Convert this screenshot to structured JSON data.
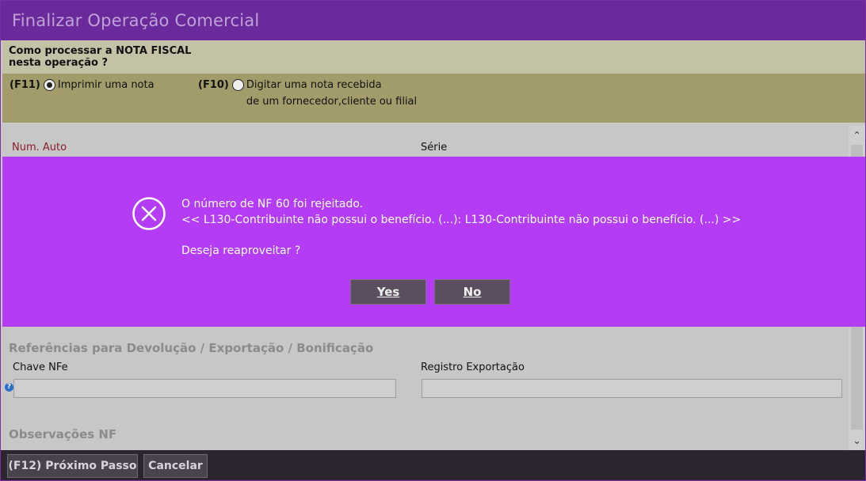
{
  "window": {
    "title": "Finalizar Operação Comercial"
  },
  "question": {
    "text_line1": "Como processar a NOTA FISCAL",
    "text_line2": "nesta operação ?"
  },
  "options": [
    {
      "key": "(F11)",
      "label_line1": "Imprimir uma nota",
      "label_line2": "",
      "selected": true
    },
    {
      "key": "(F10)",
      "label_line1": "Digitar uma nota recebida",
      "label_line2": "de um fornecedor,cliente ou filial",
      "selected": false
    }
  ],
  "form": {
    "num_auto_label": "Num. Auto",
    "serie_label": "Série",
    "references_heading": "Referências para Devolução / Exportação / Bonificação",
    "chave_nfe_label": "Chave NFe",
    "chave_nfe_value": "",
    "registro_exportacao_label": "Registro Exportação",
    "registro_exportacao_value": "",
    "observacoes_heading": "Observações NF",
    "help_glyph": "?"
  },
  "dialog": {
    "icon": "error-circle-x-icon",
    "line1": "O número de NF 60 foi rejeitado.",
    "line2": "<< L130-Contribuinte não possui o benefício. (...): L130-Contribuinte não possui o benefício. (...) >>",
    "line3": "Deseja reaproveitar ?",
    "yes_label": "Yes",
    "no_label": "No"
  },
  "footer": {
    "next_label": "(F12) Próximo Passo",
    "cancel_label": "Cancelar"
  },
  "scrollbar": {
    "up": "⌃",
    "down": "⌄"
  },
  "colors": {
    "title_bar": "#6b2a9c",
    "dialog_bg": "#b43cf5",
    "radio_row": "#a29c6a",
    "footer": "#2c2530"
  }
}
